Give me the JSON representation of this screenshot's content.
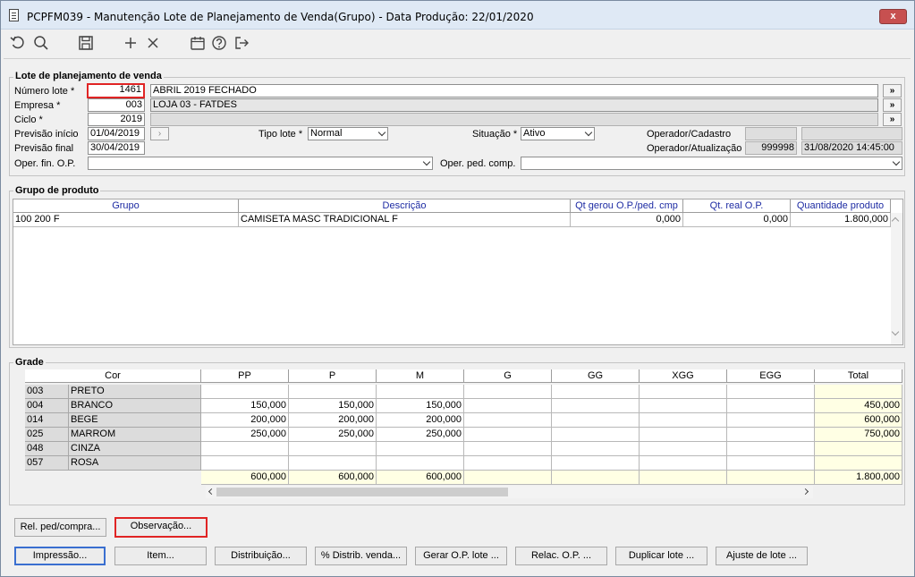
{
  "window": {
    "title": "PCPFM039 - Manutenção Lote de Planejamento de Venda(Grupo) - Data Produção: 22/01/2020",
    "close": "x"
  },
  "toolbar": {
    "icons": [
      "undo-icon",
      "search-icon",
      "save-icon",
      "add-icon",
      "delete-icon",
      "calendar-icon",
      "help-icon",
      "exit-icon"
    ]
  },
  "lote": {
    "section_title": "Lote de planejamento de venda",
    "numero_label": "Número lote *",
    "numero_value": "1461",
    "numero_desc": "ABRIL 2019 FECHADO",
    "empresa_label": "Empresa *",
    "empresa_value": "003",
    "empresa_desc": "LOJA 03 - FATDES",
    "ciclo_label": "Ciclo *",
    "ciclo_value": "2019",
    "prev_inicio_label": "Previsão início",
    "prev_inicio_value": "01/04/2019",
    "prev_final_label": "Previsão final",
    "prev_final_value": "30/04/2019",
    "tipo_label": "Tipo lote *",
    "tipo_value": "Normal",
    "situacao_label": "Situação *",
    "situacao_value": "Ativo",
    "op_cad_label": "Operador/Cadastro",
    "op_atu_label": "Operador/Atualização",
    "op_atu_id": "999998",
    "op_atu_date": "31/08/2020 14:45:00",
    "oper_fin_label": "Oper. fin. O.P.",
    "oper_ped_label": "Oper. ped. comp.",
    "lookup_glyph": "»"
  },
  "grupo": {
    "section_title": "Grupo de produto",
    "headers": [
      "Grupo",
      "Descrição",
      "Qt gerou O.P./ped. cmp",
      "Qt. real O.P.",
      "Quantidade produto"
    ],
    "rows": [
      [
        "100 200 F",
        "CAMISETA MASC TRADICIONAL F",
        "0,000",
        "0,000",
        "1.800,000"
      ]
    ]
  },
  "grade": {
    "section_title": "Grade",
    "headers": [
      "Cor",
      "PP",
      "P",
      "M",
      "G",
      "GG",
      "XGG",
      "EGG",
      "Total"
    ],
    "rows": [
      {
        "code": "003",
        "name": "PRETO",
        "vals": [
          "",
          "",
          "",
          "",
          "",
          "",
          "",
          ""
        ]
      },
      {
        "code": "004",
        "name": "BRANCO",
        "vals": [
          "150,000",
          "150,000",
          "150,000",
          "",
          "",
          "",
          "",
          "450,000"
        ]
      },
      {
        "code": "014",
        "name": "BEGE",
        "vals": [
          "200,000",
          "200,000",
          "200,000",
          "",
          "",
          "",
          "",
          "600,000"
        ]
      },
      {
        "code": "025",
        "name": "MARROM",
        "vals": [
          "250,000",
          "250,000",
          "250,000",
          "",
          "",
          "",
          "",
          "750,000"
        ]
      },
      {
        "code": "048",
        "name": "CINZA",
        "vals": [
          "",
          "",
          "",
          "",
          "",
          "",
          "",
          ""
        ]
      },
      {
        "code": "057",
        "name": "ROSA",
        "vals": [
          "",
          "",
          "",
          "",
          "",
          "",
          "",
          ""
        ]
      }
    ],
    "totals": [
      "600,000",
      "600,000",
      "600,000",
      "",
      "",
      "",
      "",
      "1.800,000"
    ]
  },
  "buttons": {
    "rel": "Rel. ped/compra...",
    "obs": "Observação...",
    "impressao": "Impressão...",
    "item": "Item...",
    "distribuicao": "Distribuição...",
    "distrib_venda": "% Distrib. venda...",
    "gerar": "Gerar O.P. lote ...",
    "relac": "Relac. O.P. ...",
    "duplicar": "Duplicar lote ...",
    "ajuste": "Ajuste de lote ..."
  }
}
